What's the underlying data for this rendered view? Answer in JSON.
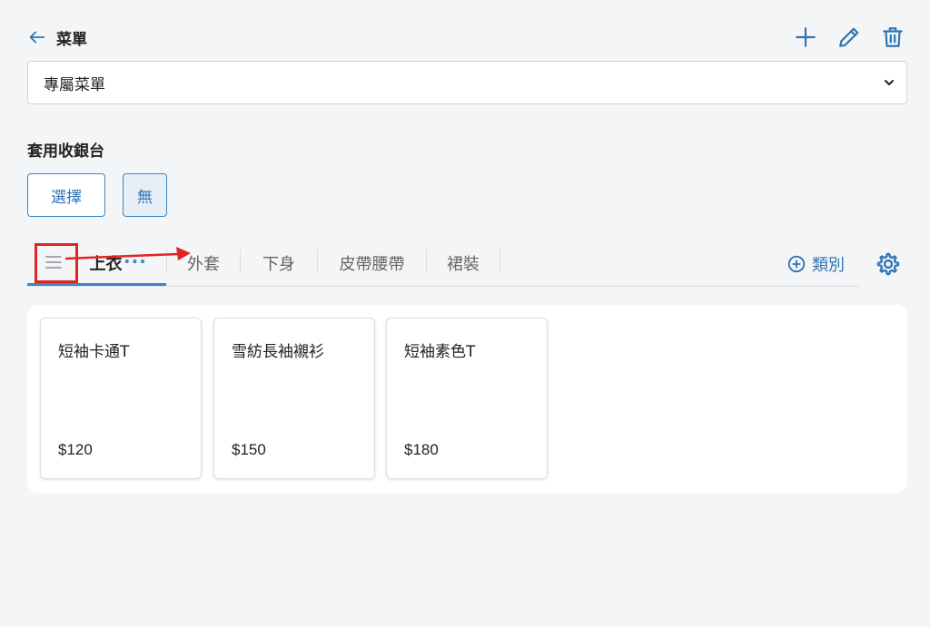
{
  "header": {
    "title": "菜單",
    "back_icon": "arrow-left-icon",
    "actions": [
      "plus-icon",
      "pencil-icon",
      "trash-icon"
    ],
    "accent_color": "#2f74b5"
  },
  "menu_select": {
    "value": "專屬菜單"
  },
  "register_section": {
    "title": "套用收銀台",
    "select_label": "選擇",
    "none_label": "無"
  },
  "tabs": {
    "items": [
      {
        "label": "上衣",
        "active": true
      },
      {
        "label": "外套",
        "active": false
      },
      {
        "label": "下身",
        "active": false
      },
      {
        "label": "皮帶腰帶",
        "active": false
      },
      {
        "label": "裙裝",
        "active": false
      }
    ],
    "more_label": "···",
    "add_category_label": "類別",
    "settings_icon": "gear-icon"
  },
  "annotation": {
    "highlight_color": "#e02424",
    "arrow_direction": "right"
  },
  "products": [
    {
      "name": "短袖卡通T",
      "price": "$120"
    },
    {
      "name": "雪紡長袖襯衫",
      "price": "$150"
    },
    {
      "name": "短袖素色T",
      "price": "$180"
    }
  ]
}
